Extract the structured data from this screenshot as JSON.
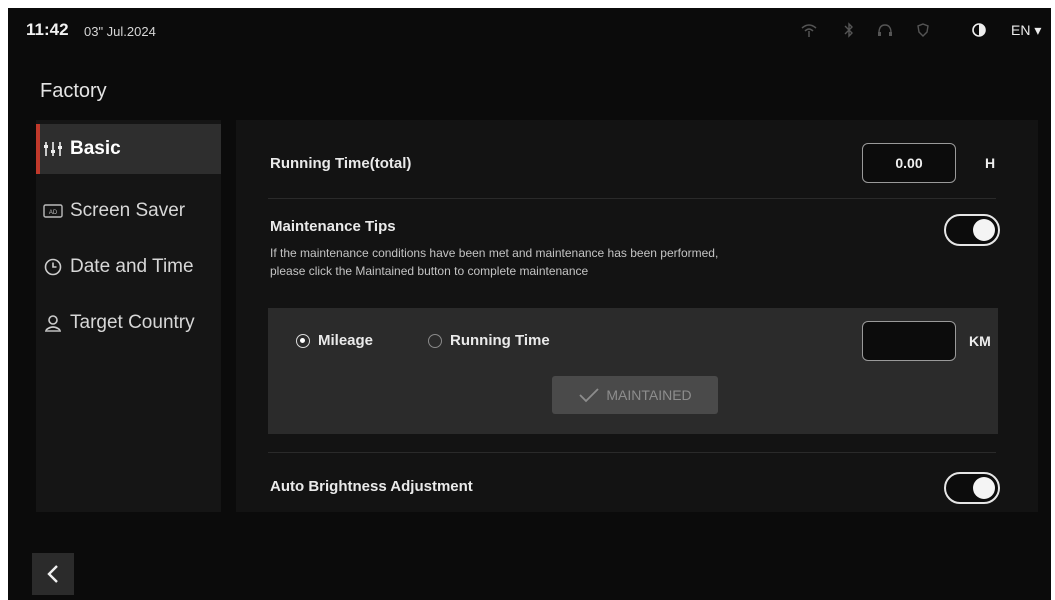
{
  "status_bar": {
    "time": "11:42",
    "date": "03\" Jul.2024",
    "icons": [
      "wifi-icon",
      "bluetooth-icon",
      "headset-icon",
      "shield-icon",
      "contrast-icon"
    ],
    "language": "EN ▾"
  },
  "page": {
    "title": "Factory"
  },
  "sidebar": {
    "items": [
      {
        "label": "Basic",
        "icon": "sliders-icon",
        "active": true
      },
      {
        "label": "Screen Saver",
        "icon": "screen-saver-icon",
        "active": false
      },
      {
        "label": "Date and Time",
        "icon": "clock-icon",
        "active": false
      },
      {
        "label": "Target Country",
        "icon": "location-person-icon",
        "active": false
      }
    ]
  },
  "main": {
    "running_time": {
      "label": "Running Time(total)",
      "value": "0.00",
      "unit": "H"
    },
    "maintenance": {
      "label": "Maintenance Tips",
      "enabled": true,
      "description_line1": "If the maintenance conditions have been met and maintenance has been performed,",
      "description_line2": "please click the Maintained button to complete maintenance",
      "options": [
        {
          "label": "Mileage",
          "selected": true
        },
        {
          "label": "Running Time",
          "selected": false
        }
      ],
      "value": "",
      "unit": "KM",
      "button_label": "MAINTAINED"
    },
    "auto_brightness": {
      "label": "Auto Brightness Adjustment",
      "enabled": true
    }
  },
  "colors": {
    "background": "#0b0b0b",
    "panel": "#131313",
    "active_item": "#2e2e2e",
    "accent_red": "#c0392b",
    "subpanel": "#2b2b2b",
    "button_disabled": "#4a4a4a"
  }
}
